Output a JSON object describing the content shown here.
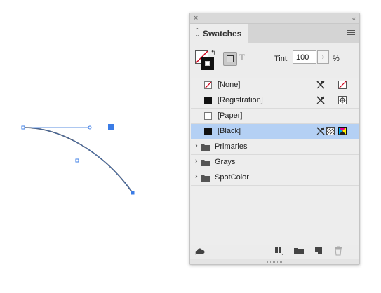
{
  "panel": {
    "tab_label": "Swatches",
    "close_glyph": "×",
    "collapse_glyph": "‹‹",
    "tab_arrows": "⌃⌄",
    "swap_glyph": "↰",
    "text_glyph": "T"
  },
  "tint": {
    "label": "Tint:",
    "value": "100",
    "stepper": "›",
    "unit": "%"
  },
  "swatches": [
    {
      "label": "[None]",
      "chip": "none-chip",
      "icons": [
        "no-edit-icon",
        "none-type-icon"
      ]
    },
    {
      "label": "[Registration]",
      "chip": "black-chip",
      "icons": [
        "no-edit-icon",
        "registration-icon"
      ]
    },
    {
      "label": "[Paper]",
      "chip": "white-chip",
      "icons": []
    },
    {
      "label": "[Black]",
      "chip": "black-chip",
      "selected": true,
      "icons": [
        "no-edit-icon",
        "process-icon",
        "cmyk-icon"
      ]
    }
  ],
  "groups": [
    {
      "label": "Primaries",
      "chevron": "›"
    },
    {
      "label": "Grays",
      "chevron": "›"
    },
    {
      "label": "SpotColor",
      "chevron": "›"
    }
  ],
  "colors": {
    "selection": "#b4d0f4",
    "path_stroke": "#1c2a44",
    "handle_blue": "#3b7ce6"
  }
}
